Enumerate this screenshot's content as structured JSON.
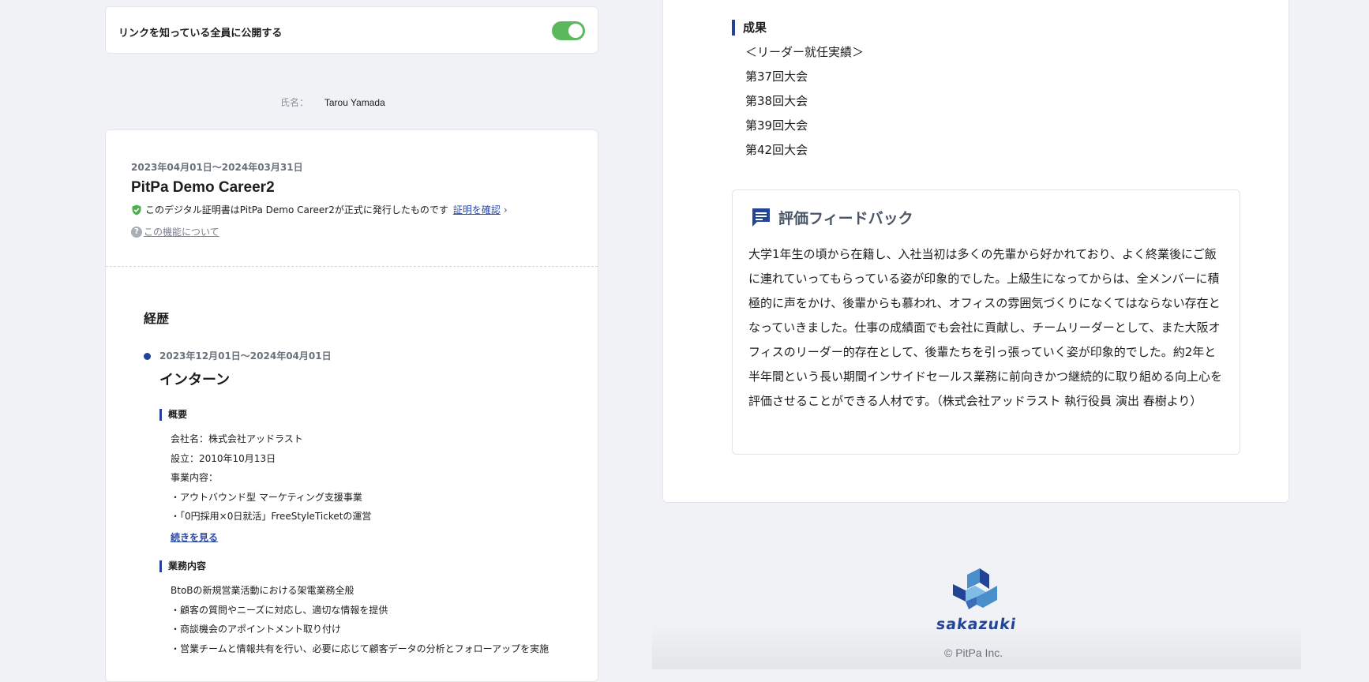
{
  "share": {
    "label": "リンクを知っている全員に公開する",
    "enabled": true
  },
  "profile": {
    "name_label": "氏名：",
    "name": "Tarou Yamada"
  },
  "certificate": {
    "period": "2023年04月01日〜2024年03月31日",
    "title": "PitPa Demo Career2",
    "note": "このデジタル証明書はPitPa Demo Career2が正式に発行したものです",
    "verify_link": "証明を確認",
    "about_link": "この機能について"
  },
  "history": {
    "heading": "経歴",
    "job": {
      "period": "2023年12月01日〜2024年04月01日",
      "title": "インターン",
      "overview_heading": "概要",
      "overview_lines": [
        "会社名：株式会社アッドラスト",
        "設立：2010年10月13日",
        "事業内容：",
        "・アウトバウンド型 マーケティング支援事業",
        "・「0円採用×0日就活」FreeStyleTicketの運営"
      ],
      "more_link": "続きを見る",
      "duties_heading": "業務内容",
      "duties_lines": [
        "BtoBの新規営業活動における架電業務全般",
        "・顧客の質問やニーズに対応し、適切な情報を提供",
        "・商談機会のアポイントメント取り付け",
        "・営業チームと情報共有を行い、必要に応じて顧客データの分析とフォローアップを実施"
      ]
    }
  },
  "results": {
    "heading": "成果",
    "lines": [
      "＜リーダー就任実績＞",
      "第37回大会",
      "第38回大会",
      "第39回大会",
      "第42回大会"
    ]
  },
  "feedback": {
    "title": "評価フィードバック",
    "text": "大学1年生の頃から在籍し、入社当初は多くの先輩から好かれており、よく終業後にご飯に連れていってもらっている姿が印象的でした。上級生になってからは、全メンバーに積極的に声をかけ、後輩からも慕われ、オフィスの雰囲気づくりになくてはならない存在となっていきました。仕事の成績面でも会社に貢献し、チームリーダーとして、また大阪オフィスのリーダー的存在として、後輩たちを引っ張っていく姿が印象的でした。約2年と半年間という長い期間インサイドセールス業務に前向きかつ継続的に取り組める向上心を評価させることができる人材です。（株式会社アッドラスト 執行役員 演出 春樹より）"
  },
  "footer": {
    "logo_text": "sakazuki",
    "copyright": "© PitPa Inc."
  },
  "colors": {
    "accent": "#234396",
    "toggle_on": "#5cb85c",
    "verified": "#4caf50"
  }
}
